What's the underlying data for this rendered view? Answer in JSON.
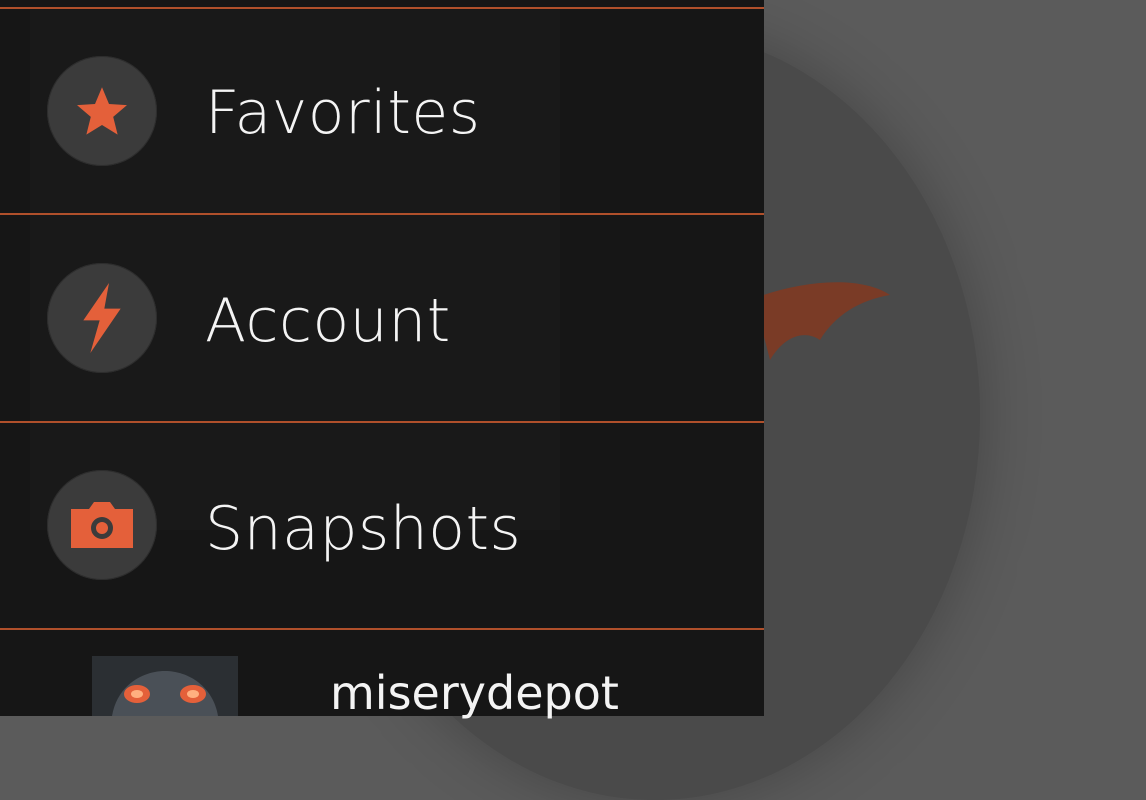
{
  "menu": {
    "items": [
      {
        "label": "Favorites",
        "icon": "star-icon"
      },
      {
        "label": "Account",
        "icon": "lightning-icon"
      },
      {
        "label": "Snapshots",
        "icon": "camera-icon"
      }
    ]
  },
  "profile": {
    "username": "miserydepot",
    "avatar_icon": "creature-avatar"
  },
  "colors": {
    "accent": "#e4603a",
    "drawer_bg": "#161616",
    "divider": "#b0502b",
    "scrim": "#5b5b5b"
  }
}
